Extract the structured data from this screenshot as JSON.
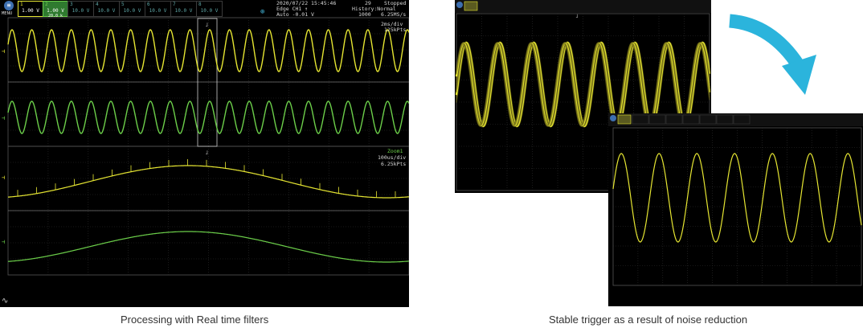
{
  "left_scope": {
    "menu_label": "MENU",
    "channels": [
      {
        "num": "1",
        "value": "1.00 V",
        "sub": "",
        "color": "#e8e830"
      },
      {
        "num": "2",
        "value": "1.00 V",
        "sub": "20.0 k",
        "color": "#6fd04f"
      },
      {
        "num": "3",
        "value": "10.0 V",
        "sub": "",
        "color": "#5fa8a8"
      },
      {
        "num": "4",
        "value": "10.0 V",
        "sub": "",
        "color": "#5fa8a8"
      },
      {
        "num": "5",
        "value": "10.0 V",
        "sub": "",
        "color": "#5fa8a8"
      },
      {
        "num": "6",
        "value": "10.0 V",
        "sub": "",
        "color": "#5fa8a8"
      },
      {
        "num": "7",
        "value": "10.0 V",
        "sub": "",
        "color": "#5fa8a8"
      },
      {
        "num": "8",
        "value": "10.0 V",
        "sub": "",
        "color": "#5fa8a8"
      }
    ],
    "datetime": "2020/07/22 15:45:46",
    "trigger_type": "Edge CH1 ↑",
    "trigger_mode": "Auto -0.01 V",
    "acq_count": "29",
    "status": "Stopped",
    "history_label": "History:Normal",
    "history_count": "1000",
    "sample_rate": "6.25MS/s",
    "main_timebase": "2ms/div",
    "main_points": "125kPts",
    "zoom_label": "Zoom1",
    "zoom_timebase": "100us/div",
    "zoom_points": "6.25kPts"
  },
  "captions": {
    "left": "Processing with Real time filters",
    "right": "Stable trigger as a result of noise reduction"
  },
  "colors": {
    "yellow": "#e6e632",
    "green": "#6ccf4a",
    "arrow": "#2bb4dc"
  }
}
